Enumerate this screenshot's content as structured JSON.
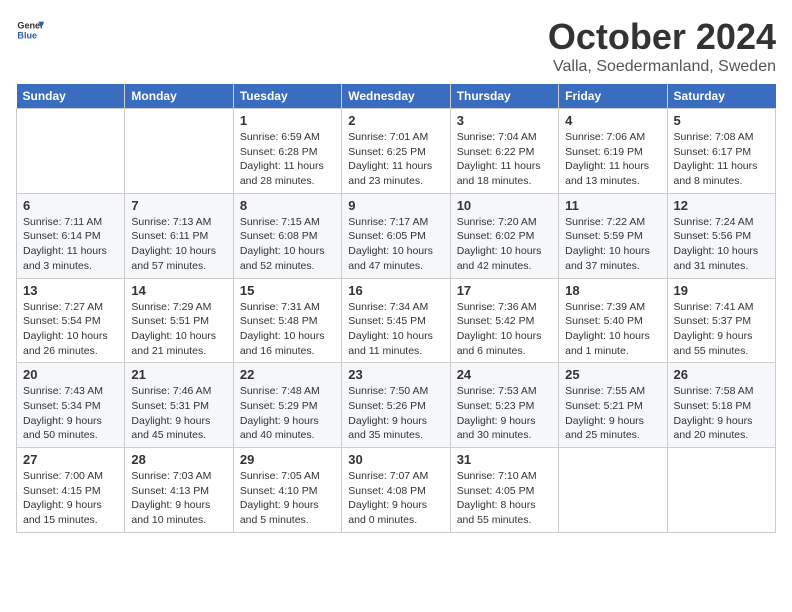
{
  "header": {
    "logo_general": "General",
    "logo_blue": "Blue",
    "month_title": "October 2024",
    "subtitle": "Valla, Soedermanland, Sweden"
  },
  "days_of_week": [
    "Sunday",
    "Monday",
    "Tuesday",
    "Wednesday",
    "Thursday",
    "Friday",
    "Saturday"
  ],
  "weeks": [
    {
      "days": [
        {
          "date": "",
          "info": ""
        },
        {
          "date": "",
          "info": ""
        },
        {
          "date": "1",
          "info": "Sunrise: 6:59 AM\nSunset: 6:28 PM\nDaylight: 11 hours and 28 minutes."
        },
        {
          "date": "2",
          "info": "Sunrise: 7:01 AM\nSunset: 6:25 PM\nDaylight: 11 hours and 23 minutes."
        },
        {
          "date": "3",
          "info": "Sunrise: 7:04 AM\nSunset: 6:22 PM\nDaylight: 11 hours and 18 minutes."
        },
        {
          "date": "4",
          "info": "Sunrise: 7:06 AM\nSunset: 6:19 PM\nDaylight: 11 hours and 13 minutes."
        },
        {
          "date": "5",
          "info": "Sunrise: 7:08 AM\nSunset: 6:17 PM\nDaylight: 11 hours and 8 minutes."
        }
      ]
    },
    {
      "days": [
        {
          "date": "6",
          "info": "Sunrise: 7:11 AM\nSunset: 6:14 PM\nDaylight: 11 hours and 3 minutes."
        },
        {
          "date": "7",
          "info": "Sunrise: 7:13 AM\nSunset: 6:11 PM\nDaylight: 10 hours and 57 minutes."
        },
        {
          "date": "8",
          "info": "Sunrise: 7:15 AM\nSunset: 6:08 PM\nDaylight: 10 hours and 52 minutes."
        },
        {
          "date": "9",
          "info": "Sunrise: 7:17 AM\nSunset: 6:05 PM\nDaylight: 10 hours and 47 minutes."
        },
        {
          "date": "10",
          "info": "Sunrise: 7:20 AM\nSunset: 6:02 PM\nDaylight: 10 hours and 42 minutes."
        },
        {
          "date": "11",
          "info": "Sunrise: 7:22 AM\nSunset: 5:59 PM\nDaylight: 10 hours and 37 minutes."
        },
        {
          "date": "12",
          "info": "Sunrise: 7:24 AM\nSunset: 5:56 PM\nDaylight: 10 hours and 31 minutes."
        }
      ]
    },
    {
      "days": [
        {
          "date": "13",
          "info": "Sunrise: 7:27 AM\nSunset: 5:54 PM\nDaylight: 10 hours and 26 minutes."
        },
        {
          "date": "14",
          "info": "Sunrise: 7:29 AM\nSunset: 5:51 PM\nDaylight: 10 hours and 21 minutes."
        },
        {
          "date": "15",
          "info": "Sunrise: 7:31 AM\nSunset: 5:48 PM\nDaylight: 10 hours and 16 minutes."
        },
        {
          "date": "16",
          "info": "Sunrise: 7:34 AM\nSunset: 5:45 PM\nDaylight: 10 hours and 11 minutes."
        },
        {
          "date": "17",
          "info": "Sunrise: 7:36 AM\nSunset: 5:42 PM\nDaylight: 10 hours and 6 minutes."
        },
        {
          "date": "18",
          "info": "Sunrise: 7:39 AM\nSunset: 5:40 PM\nDaylight: 10 hours and 1 minute."
        },
        {
          "date": "19",
          "info": "Sunrise: 7:41 AM\nSunset: 5:37 PM\nDaylight: 9 hours and 55 minutes."
        }
      ]
    },
    {
      "days": [
        {
          "date": "20",
          "info": "Sunrise: 7:43 AM\nSunset: 5:34 PM\nDaylight: 9 hours and 50 minutes."
        },
        {
          "date": "21",
          "info": "Sunrise: 7:46 AM\nSunset: 5:31 PM\nDaylight: 9 hours and 45 minutes."
        },
        {
          "date": "22",
          "info": "Sunrise: 7:48 AM\nSunset: 5:29 PM\nDaylight: 9 hours and 40 minutes."
        },
        {
          "date": "23",
          "info": "Sunrise: 7:50 AM\nSunset: 5:26 PM\nDaylight: 9 hours and 35 minutes."
        },
        {
          "date": "24",
          "info": "Sunrise: 7:53 AM\nSunset: 5:23 PM\nDaylight: 9 hours and 30 minutes."
        },
        {
          "date": "25",
          "info": "Sunrise: 7:55 AM\nSunset: 5:21 PM\nDaylight: 9 hours and 25 minutes."
        },
        {
          "date": "26",
          "info": "Sunrise: 7:58 AM\nSunset: 5:18 PM\nDaylight: 9 hours and 20 minutes."
        }
      ]
    },
    {
      "days": [
        {
          "date": "27",
          "info": "Sunrise: 7:00 AM\nSunset: 4:15 PM\nDaylight: 9 hours and 15 minutes."
        },
        {
          "date": "28",
          "info": "Sunrise: 7:03 AM\nSunset: 4:13 PM\nDaylight: 9 hours and 10 minutes."
        },
        {
          "date": "29",
          "info": "Sunrise: 7:05 AM\nSunset: 4:10 PM\nDaylight: 9 hours and 5 minutes."
        },
        {
          "date": "30",
          "info": "Sunrise: 7:07 AM\nSunset: 4:08 PM\nDaylight: 9 hours and 0 minutes."
        },
        {
          "date": "31",
          "info": "Sunrise: 7:10 AM\nSunset: 4:05 PM\nDaylight: 8 hours and 55 minutes."
        },
        {
          "date": "",
          "info": ""
        },
        {
          "date": "",
          "info": ""
        }
      ]
    }
  ]
}
